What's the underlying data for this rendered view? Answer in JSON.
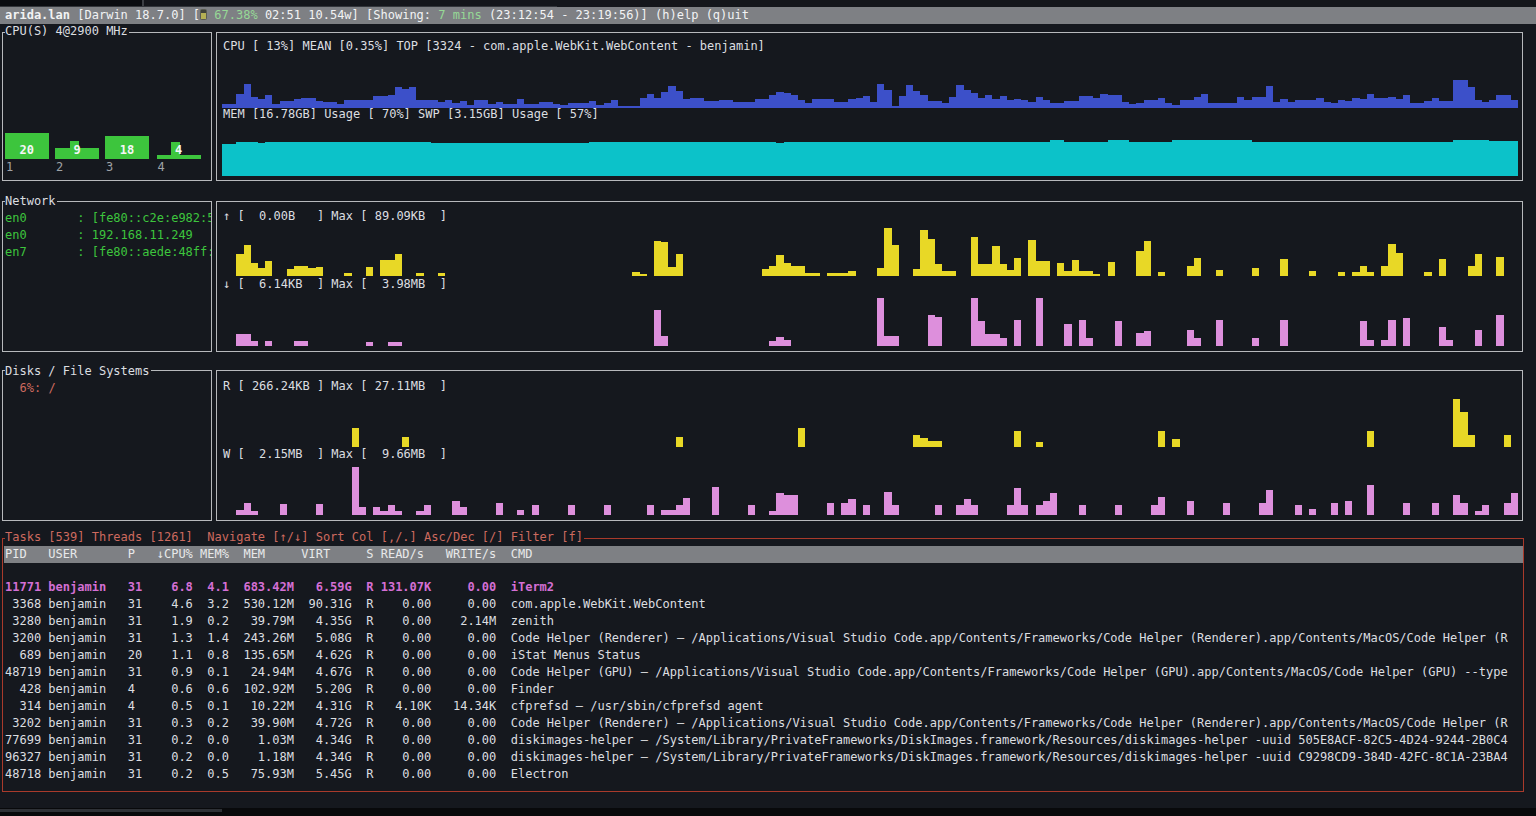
{
  "colors": {
    "bg": "#15181e",
    "topbar_bg": "#7e8084",
    "fg": "#dcdee0",
    "bright": "#f2f3f4",
    "gray_label": "#9fa2a6",
    "green": "#3dc53d",
    "pale_green": "#96d996",
    "salmon": "#cd6a5f",
    "magenta": "#d46fd4",
    "blue": "#3c50c9",
    "cyan": "#0cc2c9",
    "yellow": "#e8d826",
    "pink": "#dd8fdc",
    "box_border": "#b7b9bc",
    "red_border": "#a93a2b",
    "header_bg": "#7e8084",
    "header_fg": "#e8e9ea",
    "battery": "#b5b054"
  },
  "topbar": {
    "segments": [
      {
        "t": "arida.lan",
        "c": "bright",
        "bold": true,
        "name": "hostname"
      },
      {
        "t": " [Darwin 18.7.0] [",
        "c": "bright"
      },
      {
        "icon": "battery"
      },
      {
        "t": " ",
        "c": "bright"
      },
      {
        "t": "67.38%",
        "c": "pale_green",
        "name": "battery-percent"
      },
      {
        "t": " 02:51 10.54w] [Showing: ",
        "c": "bright"
      },
      {
        "t": "7 mins",
        "c": "pale_green",
        "name": "showing-range"
      },
      {
        "t": " (23:12:54 - 23:19:56)] ",
        "c": "bright"
      },
      {
        "t": "(h)elp",
        "c": "bright",
        "name": "help",
        "inter": true
      },
      {
        "t": " ",
        "c": "bright"
      },
      {
        "t": "(q)uit",
        "c": "bright",
        "name": "quit",
        "inter": true
      }
    ]
  },
  "cpu": {
    "title": "CPU(S) 4@2900 MHz",
    "cores": [
      {
        "axis": "1",
        "label": "20",
        "value": 20
      },
      {
        "axis": "2",
        "label": "9",
        "value": 9
      },
      {
        "axis": "3",
        "label": "18",
        "value": 18
      },
      {
        "axis": "4",
        "label": "4",
        "value": 4
      }
    ],
    "usage_line": "CPU [ 13%] MEAN [0.35%] TOP [3324 - com.apple.WebKit.WebContent - benjamin]",
    "mem_line": "MEM [16.78GB] Usage [ 70%] SWP [3.15GB] Usage [ 57%]",
    "cpu_history": [
      4,
      4,
      14,
      24,
      11,
      9,
      13,
      4,
      7,
      7,
      9,
      10,
      10,
      7,
      6,
      6,
      4,
      8,
      8,
      8,
      8,
      12,
      12,
      13,
      21,
      19,
      21,
      8,
      8,
      8,
      6,
      8,
      5,
      7,
      3,
      8,
      8,
      4,
      6,
      4,
      4,
      9,
      4,
      4,
      6,
      6,
      4,
      3,
      5,
      5,
      5,
      7,
      3,
      5,
      8,
      2,
      2,
      2,
      10,
      14,
      10,
      16,
      22,
      17,
      9,
      10,
      10,
      7,
      7,
      8,
      8,
      6,
      6,
      6,
      9,
      9,
      13,
      16,
      15,
      13,
      8,
      5,
      9,
      9,
      9,
      6,
      6,
      9,
      10,
      12,
      6,
      24,
      18,
      2,
      12,
      23,
      17,
      13,
      7,
      7,
      5,
      11,
      23,
      18,
      15,
      10,
      13,
      9,
      12,
      8,
      9,
      8,
      6,
      11,
      8,
      5,
      5,
      7,
      7,
      12,
      12,
      10,
      14,
      13,
      13,
      6,
      4,
      5,
      8,
      8,
      10,
      5,
      3,
      8,
      8,
      11,
      14,
      5,
      5,
      5,
      5,
      11,
      8,
      11,
      11,
      22,
      6,
      9,
      6,
      8,
      8,
      8,
      10,
      6,
      5,
      8,
      7,
      10,
      9,
      14,
      10,
      10,
      11,
      9,
      13,
      5,
      5,
      7,
      10,
      7,
      7,
      28,
      28,
      21,
      8,
      6,
      8,
      13,
      13,
      8
    ],
    "mem_history": [
      32,
      32,
      34,
      34,
      34,
      33,
      34,
      34,
      34,
      34,
      34,
      34,
      34,
      34,
      34,
      34,
      34,
      34,
      34,
      34,
      34,
      34,
      34,
      34,
      34,
      34,
      34,
      34,
      34,
      33,
      33,
      33,
      33,
      33,
      33,
      33,
      33,
      33,
      33,
      33,
      33,
      33,
      33,
      33,
      33,
      33,
      33,
      33,
      33,
      33,
      33,
      34,
      34,
      34,
      34,
      34,
      34,
      34,
      34,
      34,
      34,
      34,
      34,
      34,
      34,
      34,
      34,
      34,
      34,
      34,
      34,
      34,
      34,
      34,
      34,
      34,
      34,
      33,
      34,
      34,
      34,
      34,
      34,
      34,
      34,
      34,
      34,
      34,
      34,
      34,
      34,
      34,
      34,
      34,
      34,
      34,
      34,
      34,
      34,
      34,
      34,
      34,
      34,
      34,
      34,
      34,
      34,
      34,
      34,
      34,
      34,
      34,
      34,
      34,
      34,
      36,
      36,
      34,
      34,
      34,
      34,
      34,
      34,
      36,
      36,
      36,
      34,
      34,
      34,
      34,
      34,
      34,
      36,
      36,
      36,
      36,
      36,
      36,
      36,
      36,
      36,
      36,
      36,
      34,
      34,
      34,
      34,
      34,
      34,
      34,
      34,
      34,
      34,
      34,
      34,
      34,
      34,
      34,
      34,
      34,
      34,
      34,
      34,
      34,
      34,
      34,
      34,
      34,
      34,
      34,
      34,
      36,
      36,
      36,
      36,
      36,
      35,
      35,
      35,
      35
    ]
  },
  "network": {
    "title": "Network",
    "interfaces": [
      {
        "name": "en0",
        "value": "[fe80::c2e:e982:5"
      },
      {
        "name": "en0",
        "value": "192.168.11.249"
      },
      {
        "name": "en7",
        "value": "[fe80::aede:48ff:"
      }
    ],
    "up_line": "↑ [  0.00B   ] Max [ 89.09KB  ]",
    "down_line": "↓ [  6.14KB  ] Max [  3.98MB  ]",
    "up_history": [
      0,
      0,
      22,
      31,
      13,
      8,
      15,
      0,
      0,
      7,
      10,
      10,
      8,
      9,
      0,
      0,
      0,
      3,
      0,
      0,
      9,
      0,
      16,
      16,
      22,
      0,
      0,
      3,
      0,
      0,
      3,
      0,
      0,
      0,
      0,
      0,
      0,
      0,
      0,
      0,
      0,
      0,
      0,
      0,
      0,
      0,
      0,
      0,
      0,
      0,
      0,
      0,
      0,
      0,
      0,
      0,
      0,
      4,
      2,
      0,
      35,
      34,
      9,
      22,
      0,
      0,
      0,
      0,
      0,
      0,
      0,
      0,
      0,
      0,
      0,
      7,
      10,
      21,
      13,
      10,
      10,
      3,
      3,
      0,
      3,
      3,
      3,
      5,
      0,
      0,
      0,
      8,
      48,
      31,
      0,
      0,
      7,
      46,
      37,
      12,
      5,
      5,
      0,
      0,
      39,
      12,
      12,
      30,
      12,
      6,
      18,
      0,
      36,
      15,
      15,
      0,
      13,
      5,
      16,
      5,
      5,
      2,
      0,
      14,
      0,
      0,
      0,
      25,
      35,
      0,
      4,
      0,
      0,
      0,
      10,
      18,
      0,
      0,
      6,
      0,
      0,
      0,
      0,
      8,
      0,
      0,
      0,
      17,
      0,
      0,
      0,
      5,
      0,
      0,
      0,
      4,
      0,
      4,
      10,
      4,
      0,
      10,
      32,
      23,
      0,
      0,
      0,
      4,
      0,
      17,
      0,
      0,
      0,
      10,
      22,
      0,
      0,
      19,
      0,
      0
    ],
    "down_history": [
      0,
      0,
      12,
      12,
      5,
      0,
      5,
      0,
      0,
      0,
      5,
      5,
      0,
      0,
      0,
      0,
      0,
      0,
      0,
      0,
      4,
      0,
      0,
      4,
      4,
      0,
      0,
      0,
      0,
      0,
      0,
      0,
      0,
      0,
      0,
      0,
      0,
      0,
      0,
      0,
      0,
      0,
      0,
      0,
      0,
      0,
      0,
      0,
      0,
      0,
      0,
      0,
      0,
      0,
      0,
      0,
      0,
      0,
      0,
      0,
      36,
      10,
      0,
      0,
      0,
      0,
      0,
      0,
      0,
      0,
      0,
      0,
      0,
      0,
      0,
      0,
      5,
      9,
      6,
      0,
      0,
      0,
      0,
      0,
      0,
      0,
      0,
      0,
      0,
      0,
      0,
      48,
      10,
      10,
      0,
      0,
      0,
      0,
      31,
      29,
      0,
      0,
      0,
      0,
      48,
      25,
      12,
      12,
      8,
      0,
      26,
      0,
      0,
      48,
      0,
      0,
      0,
      22,
      0,
      26,
      8,
      0,
      0,
      0,
      25,
      0,
      0,
      13,
      15,
      0,
      0,
      0,
      0,
      0,
      16,
      8,
      0,
      0,
      26,
      0,
      0,
      0,
      0,
      8,
      0,
      0,
      0,
      26,
      0,
      0,
      0,
      0,
      0,
      0,
      0,
      0,
      0,
      0,
      25,
      6,
      0,
      6,
      26,
      0,
      28,
      0,
      0,
      0,
      0,
      19,
      6,
      0,
      0,
      0,
      16,
      0,
      0,
      31,
      0,
      0
    ]
  },
  "disks": {
    "title": "Disks / File Systems",
    "usage": "6%: /",
    "read_line": "R [ 266.24KB ] Max [ 27.11MB  ]",
    "write_line": "W [  2.15MB  ] Max [  9.66MB  ]",
    "read_history": [
      0,
      0,
      0,
      0,
      0,
      0,
      0,
      0,
      0,
      0,
      0,
      0,
      0,
      0,
      0,
      0,
      0,
      0,
      19,
      0,
      0,
      0,
      0,
      0,
      0,
      10,
      0,
      0,
      0,
      0,
      0,
      0,
      0,
      0,
      0,
      0,
      0,
      0,
      0,
      0,
      0,
      0,
      0,
      0,
      0,
      0,
      0,
      0,
      0,
      0,
      0,
      0,
      0,
      0,
      0,
      0,
      0,
      0,
      0,
      0,
      0,
      0,
      0,
      10,
      0,
      0,
      0,
      0,
      0,
      0,
      0,
      0,
      0,
      0,
      0,
      0,
      0,
      0,
      0,
      0,
      19,
      0,
      0,
      0,
      0,
      0,
      0,
      0,
      0,
      0,
      0,
      0,
      0,
      0,
      0,
      0,
      12,
      9,
      6,
      6,
      0,
      0,
      0,
      0,
      0,
      0,
      0,
      0,
      0,
      0,
      16,
      0,
      0,
      5,
      0,
      0,
      0,
      0,
      0,
      0,
      0,
      0,
      0,
      0,
      0,
      0,
      0,
      0,
      0,
      0,
      16,
      0,
      8,
      0,
      0,
      0,
      0,
      0,
      0,
      0,
      0,
      0,
      0,
      0,
      0,
      0,
      0,
      0,
      0,
      0,
      0,
      0,
      0,
      0,
      0,
      0,
      0,
      0,
      0,
      16,
      0,
      0,
      0,
      0,
      0,
      0,
      0,
      0,
      0,
      0,
      0,
      48,
      35,
      12,
      0,
      0,
      0,
      0,
      12,
      0
    ],
    "write_history": [
      0,
      0,
      5,
      12,
      4,
      0,
      0,
      0,
      11,
      0,
      0,
      0,
      0,
      11,
      0,
      0,
      0,
      0,
      48,
      8,
      0,
      8,
      4,
      10,
      4,
      0,
      0,
      4,
      10,
      0,
      0,
      0,
      14,
      8,
      0,
      0,
      0,
      0,
      12,
      0,
      0,
      5,
      0,
      10,
      0,
      0,
      0,
      0,
      10,
      0,
      0,
      0,
      0,
      10,
      0,
      0,
      0,
      0,
      0,
      10,
      0,
      5,
      5,
      10,
      17,
      0,
      0,
      0,
      28,
      0,
      0,
      0,
      0,
      10,
      0,
      0,
      4,
      22,
      20,
      20,
      0,
      0,
      0,
      0,
      12,
      0,
      12,
      16,
      0,
      10,
      0,
      0,
      23,
      10,
      0,
      0,
      0,
      0,
      0,
      10,
      0,
      0,
      10,
      16,
      10,
      0,
      0,
      0,
      0,
      10,
      27,
      10,
      0,
      10,
      14,
      22,
      0,
      0,
      0,
      10,
      0,
      0,
      0,
      0,
      10,
      0,
      0,
      0,
      0,
      10,
      18,
      0,
      0,
      0,
      14,
      0,
      0,
      0,
      0,
      12,
      0,
      0,
      0,
      0,
      12,
      25,
      0,
      0,
      0,
      10,
      0,
      6,
      0,
      0,
      12,
      0,
      14,
      0,
      0,
      30,
      0,
      0,
      0,
      0,
      12,
      0,
      0,
      0,
      12,
      0,
      0,
      20,
      12,
      0,
      4,
      10,
      0,
      0,
      12,
      22
    ]
  },
  "tasks": {
    "title": "Tasks [539] Threads [1261]  Navigate [↑/↓] Sort Col [,/.] Asc/Dec [/] Filter [f]",
    "columns": [
      "PID",
      "USER",
      "P",
      "↓CPU%",
      "MEM%",
      "MEM",
      "VIRT",
      "S",
      "READ/s",
      "WRITE/s",
      "CMD"
    ],
    "selected_index": 0,
    "rows": [
      {
        "pid": "11771",
        "user": "benjamin",
        "p": "31",
        "cpu": "6.8",
        "memp": "4.1",
        "mem": "683.42M",
        "virt": "6.59G",
        "s": "R",
        "read": "131.07K",
        "write": "0.00",
        "cmd": "iTerm2"
      },
      {
        "pid": "3368",
        "user": "benjamin",
        "p": "31",
        "cpu": "4.6",
        "memp": "3.2",
        "mem": "530.12M",
        "virt": "90.31G",
        "s": "R",
        "read": "0.00",
        "write": "0.00",
        "cmd": "com.apple.WebKit.WebContent"
      },
      {
        "pid": "3280",
        "user": "benjamin",
        "p": "31",
        "cpu": "1.9",
        "memp": "0.2",
        "mem": "39.79M",
        "virt": "4.35G",
        "s": "R",
        "read": "0.00",
        "write": "2.14M",
        "cmd": "zenith"
      },
      {
        "pid": "3200",
        "user": "benjamin",
        "p": "31",
        "cpu": "1.3",
        "memp": "1.4",
        "mem": "243.26M",
        "virt": "5.08G",
        "s": "R",
        "read": "0.00",
        "write": "0.00",
        "cmd": "Code Helper (Renderer) — /Applications/Visual Studio Code.app/Contents/Frameworks/Code Helper (Renderer).app/Contents/MacOS/Code Helper (R"
      },
      {
        "pid": "689",
        "user": "benjamin",
        "p": "20",
        "cpu": "1.1",
        "memp": "0.8",
        "mem": "135.65M",
        "virt": "4.62G",
        "s": "R",
        "read": "0.00",
        "write": "0.00",
        "cmd": "iStat Menus Status"
      },
      {
        "pid": "48719",
        "user": "benjamin",
        "p": "31",
        "cpu": "0.9",
        "memp": "0.1",
        "mem": "24.94M",
        "virt": "4.67G",
        "s": "R",
        "read": "0.00",
        "write": "0.00",
        "cmd": "Code Helper (GPU) — /Applications/Visual Studio Code.app/Contents/Frameworks/Code Helper (GPU).app/Contents/MacOS/Code Helper (GPU) --type"
      },
      {
        "pid": "428",
        "user": "benjamin",
        "p": "4",
        "cpu": "0.6",
        "memp": "0.6",
        "mem": "102.92M",
        "virt": "5.20G",
        "s": "R",
        "read": "0.00",
        "write": "0.00",
        "cmd": "Finder"
      },
      {
        "pid": "314",
        "user": "benjamin",
        "p": "4",
        "cpu": "0.5",
        "memp": "0.1",
        "mem": "10.22M",
        "virt": "4.31G",
        "s": "R",
        "read": "4.10K",
        "write": "14.34K",
        "cmd": "cfprefsd — /usr/sbin/cfprefsd agent"
      },
      {
        "pid": "3202",
        "user": "benjamin",
        "p": "31",
        "cpu": "0.3",
        "memp": "0.2",
        "mem": "39.90M",
        "virt": "4.72G",
        "s": "R",
        "read": "0.00",
        "write": "0.00",
        "cmd": "Code Helper (Renderer) — /Applications/Visual Studio Code.app/Contents/Frameworks/Code Helper (Renderer).app/Contents/MacOS/Code Helper (R"
      },
      {
        "pid": "77699",
        "user": "benjamin",
        "p": "31",
        "cpu": "0.2",
        "memp": "0.0",
        "mem": "1.03M",
        "virt": "4.34G",
        "s": "R",
        "read": "0.00",
        "write": "0.00",
        "cmd": "diskimages-helper — /System/Library/PrivateFrameworks/DiskImages.framework/Resources/diskimages-helper -uuid 505E8ACF-82C5-4D24-9244-2B0C4"
      },
      {
        "pid": "96327",
        "user": "benjamin",
        "p": "31",
        "cpu": "0.2",
        "memp": "0.0",
        "mem": "1.18M",
        "virt": "4.34G",
        "s": "R",
        "read": "0.00",
        "write": "0.00",
        "cmd": "diskimages-helper — /System/Library/PrivateFrameworks/DiskImages.framework/Resources/diskimages-helper -uuid C9298CD9-384D-42FC-8C1A-23BA4"
      },
      {
        "pid": "48718",
        "user": "benjamin",
        "p": "31",
        "cpu": "0.2",
        "memp": "0.5",
        "mem": "75.93M",
        "virt": "5.45G",
        "s": "R",
        "read": "0.00",
        "write": "0.00",
        "cmd": "Electron"
      }
    ]
  }
}
